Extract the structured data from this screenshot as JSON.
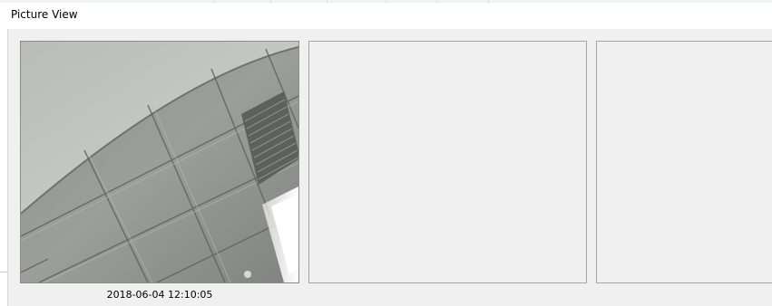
{
  "window": {
    "title": "Picture View"
  },
  "panes": [
    {
      "image": "ceiling-camera-snapshot",
      "timestamp": "2018-06-04 12:10:05"
    },
    {
      "image": ""
    },
    {
      "image": ""
    }
  ]
}
